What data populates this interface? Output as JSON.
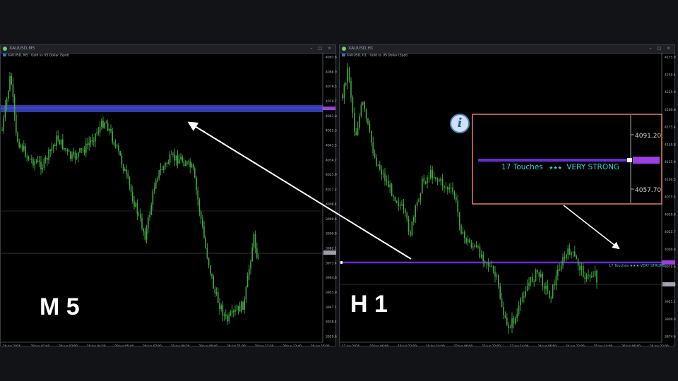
{
  "left_window": {
    "title": "XAUUSD,M5",
    "chart_info": "XAUUSD, M5 · Gold vs US Dollar (Spot)",
    "timeframe_label": "M 5",
    "price_ticks": [
      "4097.65",
      "4088.90",
      "4079.50",
      "4070.70",
      "4061.05",
      "4052.30",
      "4043.55",
      "4034.70",
      "4025.95",
      "4017.20",
      "4008.45",
      "3999.65",
      "3990.90",
      "3982.15",
      "3973.40",
      "3964.65",
      "3955.90",
      "3947.10",
      "3938.40",
      "3929.65"
    ],
    "current_price": "4061.05",
    "line_price": "3973.40",
    "time_ticks": [
      "28 Jun 2026",
      "29 Jun 01:40",
      "29 Jun 03:00",
      "29 Jun 04:20",
      "29 Jun 05:40",
      "29 Jun 07:00",
      "29 Jun 08:20",
      "29 Jun 09:40",
      "29 Jun 11:00",
      "29 Jun 12:20",
      "29 Jun 13:40",
      "29 Jun 15:00"
    ]
  },
  "right_window": {
    "title": "XAUUSD,H1",
    "chart_info": "XAUUSD, H1 · Gold vs US Dollar (Spot)",
    "timeframe_label": "H 1",
    "price_ticks": [
      "4275.90",
      "4250.45",
      "4225.90",
      "4200.60",
      "4175.40",
      "4150.85",
      "4125.90",
      "4100.50",
      "4075.50",
      "4050.90",
      "4025.70",
      "4000.80",
      "3975.60",
      "3950.85",
      "3925.10",
      "3900.05",
      "3874.60"
    ],
    "line_price": "3966.96",
    "current_price": "3940.50",
    "time_ticks": [
      "17 Jun 2026",
      "18 Jun 06:00",
      "18 Jun 22:00",
      "19 Jun 14:00",
      "22 Jun 06:00",
      "22 Jun 22:00",
      "23 Jun 14:00",
      "24 Jun 06:00",
      "24 Jun 22:00",
      "25 Jun 14:00",
      "26 Jun 06:00",
      "26 Jun 22:00"
    ],
    "zone_label": "17 Touches ★★★ VERY STRONG"
  },
  "zoom_box": {
    "price_high": "4091.20",
    "price_low": "4057.70",
    "zone_label_prefix": "17 Touches",
    "zone_stars": "★★★",
    "zone_label_suffix": "VERY STRONG"
  },
  "colors": {
    "candle": "#3fa83f",
    "zone_band": "#1f47a3",
    "zone_line": "#6a2bd6",
    "zoom_border": "#e0865a",
    "zone_text": "#2fd4d4",
    "arrow": "#ffffff"
  },
  "icons": {
    "info": "info-icon"
  },
  "info_symbol": "i"
}
